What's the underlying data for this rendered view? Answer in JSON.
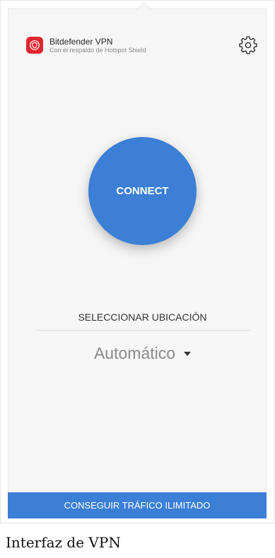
{
  "app": {
    "name": "Bitdefender VPN",
    "subtitle": "Con el respaldo de Hotspot Shield",
    "logo_icon": "shield-icon",
    "logo_color": "#e2262f"
  },
  "header": {
    "settings_icon": "gear-icon"
  },
  "main": {
    "connect_label": "CONNECT",
    "location_heading": "SELECCIONAR UBICACIÓN",
    "location_value": "Automático",
    "dropdown_icon": "caret-down-icon"
  },
  "footer": {
    "upgrade_label": "CONSEGUIR TRÁFICO ILIMITADO"
  },
  "caption": "Interfaz de VPN",
  "colors": {
    "accent": "#3b7fd7",
    "background": "#f6f6f6"
  }
}
